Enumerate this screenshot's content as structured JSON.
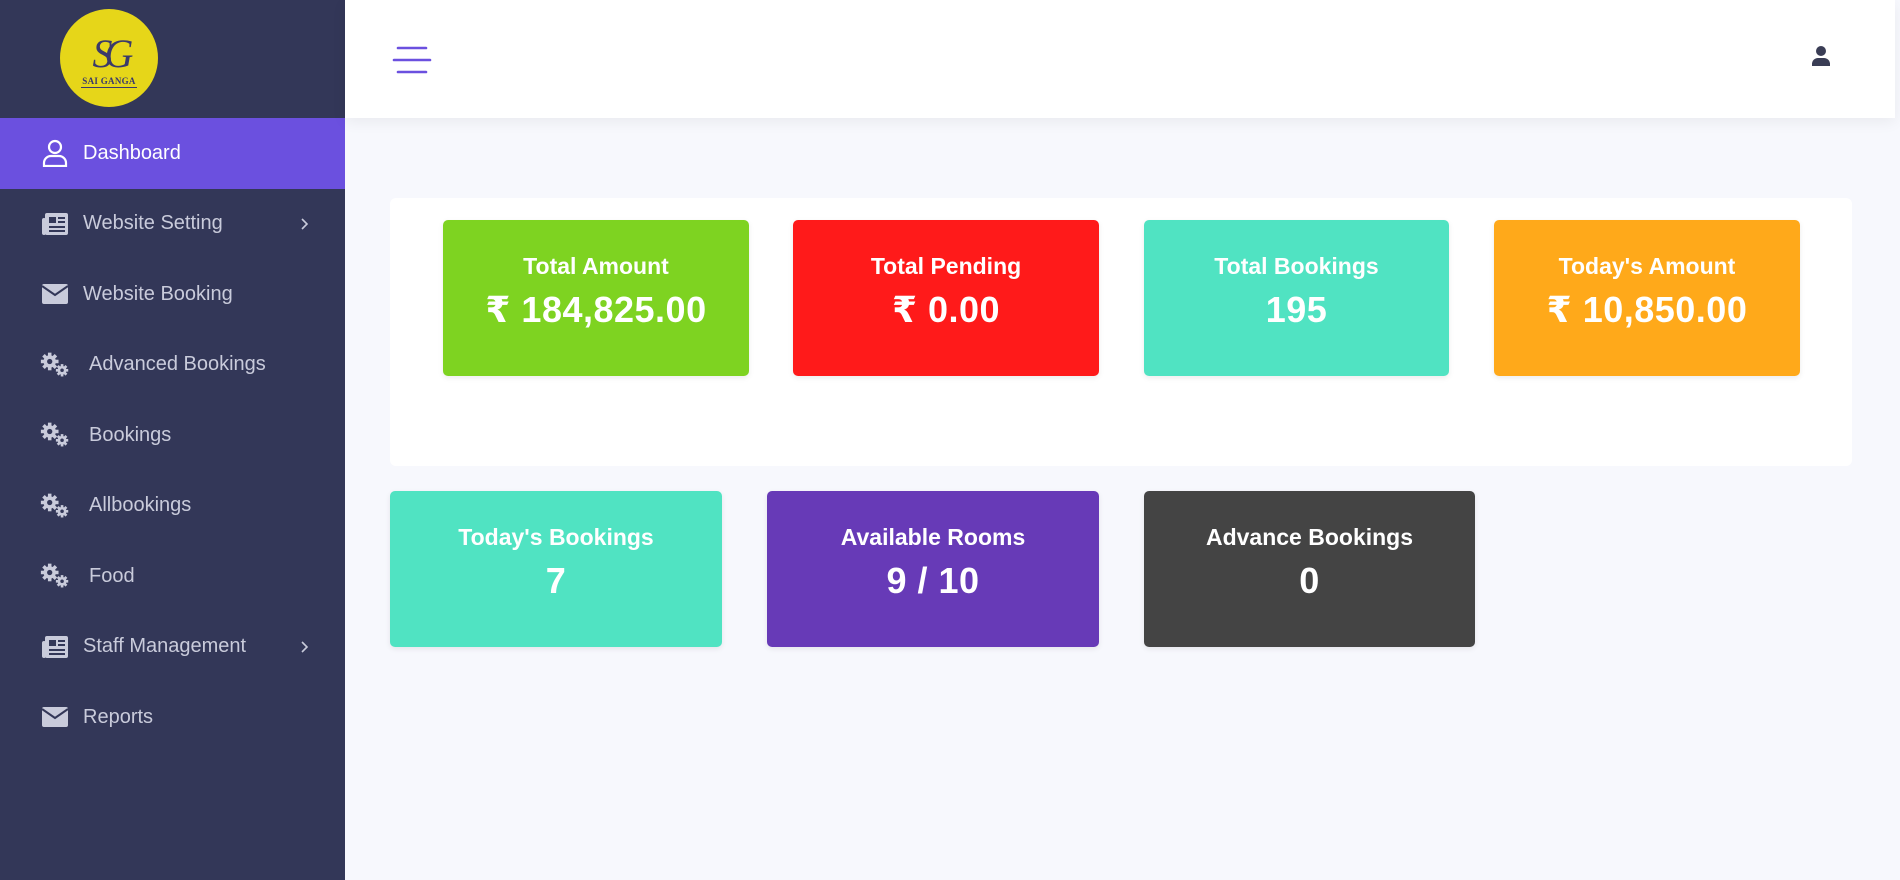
{
  "brand": {
    "monogram": "SG",
    "name": "SAI GANGA"
  },
  "sidebar": {
    "items": [
      {
        "label": "Dashboard",
        "icon": "user-icon",
        "active": true,
        "has_submenu": false
      },
      {
        "label": "Website Setting",
        "icon": "newspaper-icon",
        "active": false,
        "has_submenu": true
      },
      {
        "label": "Website Booking",
        "icon": "envelope-icon",
        "active": false,
        "has_submenu": false
      },
      {
        "label": "Advanced Bookings",
        "icon": "gears-icon",
        "active": false,
        "has_submenu": false
      },
      {
        "label": "Bookings",
        "icon": "gears-icon",
        "active": false,
        "has_submenu": false
      },
      {
        "label": "Allbookings",
        "icon": "gears-icon",
        "active": false,
        "has_submenu": false
      },
      {
        "label": "Food",
        "icon": "gears-icon",
        "active": false,
        "has_submenu": false
      },
      {
        "label": "Staff Management",
        "icon": "newspaper-icon",
        "active": false,
        "has_submenu": true
      },
      {
        "label": "Reports",
        "icon": "envelope-icon",
        "active": false,
        "has_submenu": false
      }
    ]
  },
  "topbar": {
    "menu_icon": "hamburger-icon",
    "account_icon": "user-icon"
  },
  "stats_top": [
    {
      "title": "Total Amount",
      "value": "₹ 184,825.00",
      "color": "#7ed321"
    },
    {
      "title": "Total Pending",
      "value": "₹ 0.00",
      "color": "#ff1a1a"
    },
    {
      "title": "Total Bookings",
      "value": "195",
      "color": "#50e3c2"
    },
    {
      "title": "Today's Amount",
      "value": "₹ 10,850.00",
      "color": "#ffa91a"
    }
  ],
  "stats_bottom": [
    {
      "title": "Today's Bookings",
      "value": "7",
      "color": "#50e3c2"
    },
    {
      "title": "Available Rooms",
      "value": "9 / 10",
      "color": "#673ab7"
    },
    {
      "title": "Advance Bookings",
      "value": "0",
      "color": "#444444"
    }
  ],
  "colors": {
    "sidebar_bg": "#333758",
    "active_item": "#6b50df",
    "page_bg": "#f7f8fd",
    "logo_bg": "#e6d619"
  }
}
